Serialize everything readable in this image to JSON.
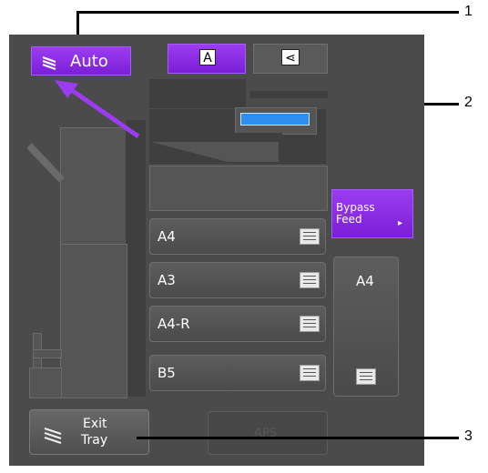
{
  "callouts": [
    "1",
    "2",
    "3"
  ],
  "top_bar": {
    "auto_label": "Auto",
    "orient_portrait_glyph": "A",
    "orient_landscape_glyph": "⋖"
  },
  "trays": [
    {
      "label": "A4"
    },
    {
      "label": "A3"
    },
    {
      "label": "A4-R"
    },
    {
      "label": "B5"
    }
  ],
  "bypass": {
    "line1": "Bypass",
    "line2": "Feed",
    "arrow": "▸"
  },
  "bypass_paper": {
    "label": "A4"
  },
  "exit_tray": {
    "line1": "Exit",
    "line2": "Tray"
  },
  "aps": {
    "label": "APS"
  },
  "colors": {
    "accent": "#8a2be2",
    "panel": "#4b4b4b",
    "display": "#2f8ff0"
  },
  "icons": [
    "paper-stack-icon",
    "auto-paper-icon",
    "exit-tray-icon",
    "arrow-right-icon",
    "route-arrow-icon"
  ]
}
